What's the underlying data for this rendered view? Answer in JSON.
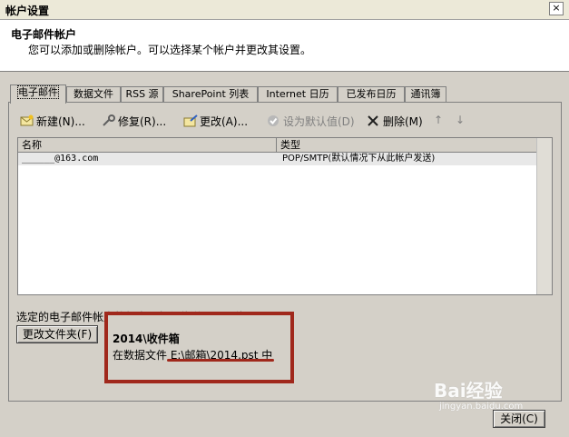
{
  "window": {
    "title": "帐户设置",
    "close_symbol": "×"
  },
  "header": {
    "heading": "电子邮件帐户",
    "subtitle": "您可以添加或删除帐户。可以选择某个帐户并更改其设置。"
  },
  "tabs": [
    {
      "label": "电子邮件"
    },
    {
      "label": "数据文件"
    },
    {
      "label": "RSS 源"
    },
    {
      "label": "SharePoint 列表"
    },
    {
      "label": "Internet 日历"
    },
    {
      "label": "已发布日历"
    },
    {
      "label": "通讯簿"
    }
  ],
  "toolbar": {
    "new": "新建(N)...",
    "repair": "修复(R)...",
    "change": "更改(A)...",
    "set_default": "设为默认值(D)",
    "remove": "删除(M)",
    "up_symbol": "↑",
    "down_symbol": "↓"
  },
  "list": {
    "col_name": "名称",
    "col_type": "类型",
    "rows": [
      {
        "name": "______@163.com",
        "type": "POP/SMTP(默认情况下从此帐户发送)"
      }
    ]
  },
  "footer": {
    "description": "选定的电子邮件帐户将新电子邮件传送到以下位置:",
    "change_folder_button": "更改文件夹(F)",
    "inbox_title": "2014\\收件箱",
    "inbox_path": "在数据文件 E:\\邮箱\\2014.pst 中",
    "close_button": "关闭(C)"
  },
  "watermark": {
    "text": "Bai经验",
    "sub": "jingyan.baidu.com"
  },
  "colors": {
    "highlight_box": "#a0281c",
    "dialog_bg": "#d4d0c8"
  }
}
